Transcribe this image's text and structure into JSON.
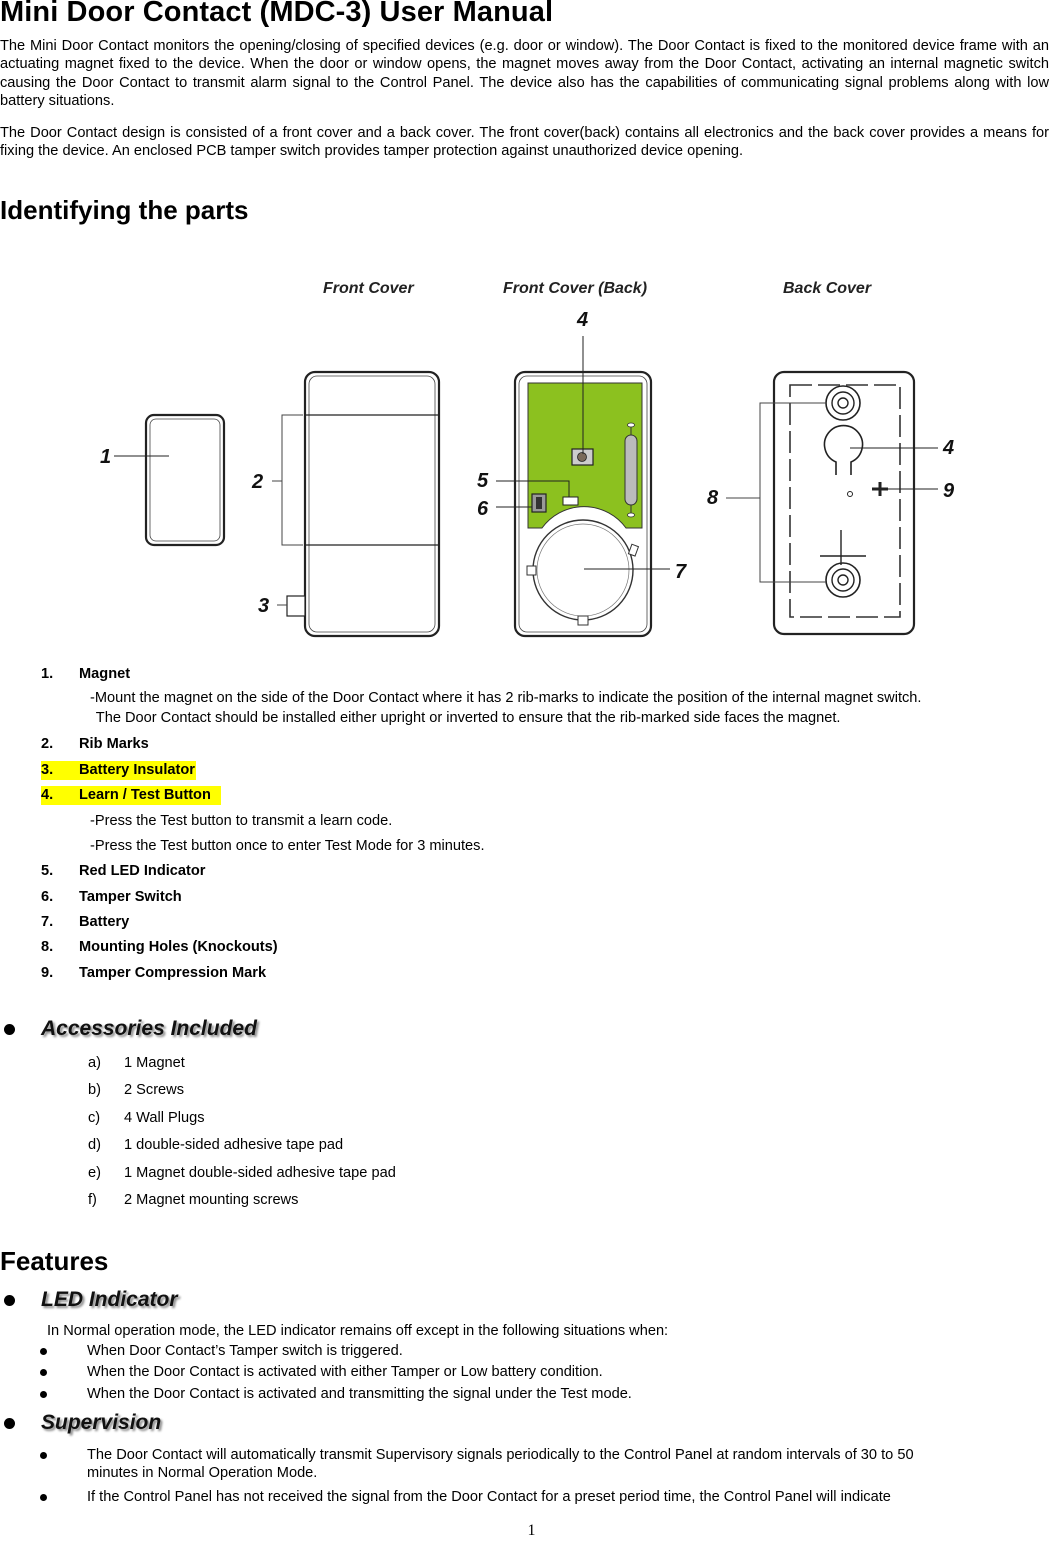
{
  "document": {
    "title": "Mini Door Contact (MDC-3) User Manual",
    "intro_paragraphs": [
      "The Mini Door Contact monitors the opening/closing of specified devices (e.g. door or window). The Door Contact is fixed to the monitored device frame with an actuating magnet fixed to the device. When the door or window opens, the magnet moves away from the Door Contact, activating an internal magnetic switch causing the Door Contact to transmit alarm signal to the Control Panel. The device also has the capabilities of communicating signal problems along with low battery situations.",
      "The Door Contact design is consisted of a front cover and a back cover. The front cover(back) contains all electronics and the back cover provides a means for fixing the device. An enclosed PCB tamper switch provides tamper protection against unauthorized device opening."
    ],
    "page_number": "1"
  },
  "identifying": {
    "heading": "Identifying the parts",
    "diagram": {
      "captions": [
        "Front Cover",
        "Front Cover (Back)",
        "Back Cover"
      ],
      "callouts": [
        "1",
        "2",
        "3",
        "4",
        "5",
        "6",
        "7",
        "8",
        "4",
        "9"
      ],
      "pcb_color": "#8cc11f"
    },
    "parts": [
      {
        "num": "1.",
        "label": "Magnet",
        "highlight": false,
        "notes": [
          "-Mount the magnet on the side of the Door Contact where it has 2 rib-marks to indicate the position of the internal magnet switch.",
          " The Door Contact should be installed either upright or inverted to ensure that the rib-marked side faces the magnet."
        ]
      },
      {
        "num": "2.",
        "label": "Rib Marks",
        "highlight": false,
        "notes": []
      },
      {
        "num": "3.",
        "label": "Battery Insulator",
        "highlight": true,
        "notes": []
      },
      {
        "num": "4.",
        "label": "Learn / Test Button",
        "highlight": true,
        "notes": [
          "-Press the Test button to transmit a learn code.",
          "-Press the Test button once to enter Test Mode for 3 minutes."
        ]
      },
      {
        "num": "5.",
        "label": "Red LED Indicator",
        "highlight": false,
        "notes": []
      },
      {
        "num": "6.",
        "label": "Tamper Switch",
        "highlight": false,
        "notes": []
      },
      {
        "num": "7.",
        "label": "Battery",
        "highlight": false,
        "notes": []
      },
      {
        "num": "8.",
        "label": "Mounting Holes (Knockouts)",
        "highlight": false,
        "notes": []
      },
      {
        "num": "9.",
        "label": "Tamper Compression Mark",
        "highlight": false,
        "notes": []
      }
    ],
    "highlight_color": "#ffff00"
  },
  "accessories": {
    "heading": "Accessories Included",
    "items": [
      {
        "letter": "a)",
        "text": "1 Magnet"
      },
      {
        "letter": "b)",
        "text": "2 Screws"
      },
      {
        "letter": "c)",
        "text": "4 Wall Plugs"
      },
      {
        "letter": "d)",
        "text": "1 double-sided adhesive tape pad"
      },
      {
        "letter": "e)",
        "text": "1 Magnet double-sided adhesive tape pad"
      },
      {
        "letter": "f)",
        "text": "2 Magnet mounting screws"
      }
    ]
  },
  "features": {
    "heading": "Features",
    "led": {
      "heading": "LED Indicator",
      "intro": "In Normal operation mode, the LED indicator remains off except in the following situations when:",
      "bullets": [
        "When Door Contact’s Tamper switch is triggered.",
        "When the Door Contact is activated with either Tamper or Low battery condition.",
        "When the Door Contact is activated and transmitting the signal under the Test mode."
      ]
    },
    "supervision": {
      "heading": "Supervision",
      "bullets": [
        {
          "line1": "The Door Contact will automatically transmit Supervisory signals periodically to the Control Panel at random intervals of 30 to 50",
          "line2": "minutes in Normal Operation Mode."
        },
        {
          "line1": "If the Control Panel has not received the signal from the Door Contact for a preset period time, the Control Panel will indicate",
          "line2": ""
        }
      ]
    }
  }
}
